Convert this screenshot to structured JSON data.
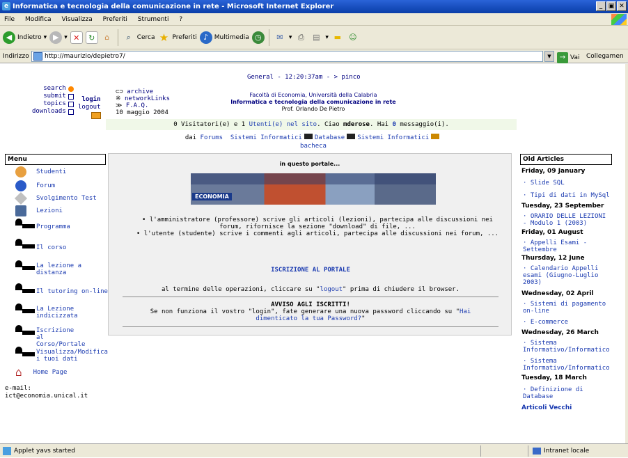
{
  "window": {
    "title": "Informatica e tecnologia della comunicazione in rete - Microsoft Internet Explorer",
    "min": "_",
    "max": " ",
    "close": " "
  },
  "menubar": [
    "File",
    "Modifica",
    "Visualizza",
    "Preferiti",
    "Strumenti",
    "?"
  ],
  "toolbar": {
    "back": "Indietro",
    "search": "Cerca",
    "favorites": "Preferiti",
    "media": "Multimedia"
  },
  "address": {
    "label": "Indirizzo",
    "url": "http://maurizio/depietro7/",
    "go": "Vai",
    "links": "Collegamen"
  },
  "page": {
    "general": "General - 12:20:37am - > pinco",
    "leftlinks": {
      "search": "search",
      "submit": "submit",
      "topics": "topics",
      "downloads": "downloads"
    },
    "login": "login",
    "logout": "logout",
    "rightlinks": {
      "archive": "archive",
      "network": "networkLinks",
      "faq": "F.A.Q.",
      "date": "10 maggio 2004"
    },
    "faculty": "Facoltà di Economia, Università della Calabria",
    "course": "Informatica e tecnologia della comunicazione in rete",
    "prof": "Prof. Orlando De Pietro",
    "visitors": {
      "pre": "0 Visitatori(e) e 1",
      "users": "Utenti(e) nel sito",
      "hello": ". Ciao",
      "user": "mderose",
      "has": ". Hai",
      "msgcount": "0",
      "msg": "messaggio(i)."
    },
    "dai": {
      "pre": "dai",
      "forums": "Forums",
      "si1": "Sistemi Informatici",
      "db": "Database",
      "si2": "Sistemi Informatici",
      "bacheca": "bacheca"
    },
    "menu": {
      "title": "Menu",
      "items": [
        "Studenti",
        "Forum",
        "Svolgimento Test",
        "Lezioni"
      ],
      "pict": [
        "Programma",
        "Il corso",
        "La lezione a distanza",
        "Il tutoring on-line",
        "La Lezione indicizzata",
        "Iscrizione al Corso/Portale",
        "Visualizza/Modifica i tuoi dati"
      ],
      "home": "Home Page"
    },
    "email_label": "e-mail:",
    "email": "ict@economia.unical.it",
    "main": {
      "heading": "in questo portale...",
      "banner": "ECONOMIA",
      "bullet1": "l'amministratore (professore) scrive gli articoli (lezioni), partecipa alle discussioni nei forum, rifornisce la sezione \"download\" di file, ...",
      "bullet2": "l'utente (studente) scrive i commenti agli articoli, partecipa alle discussioni nei forum, ...",
      "iscr": "ISCRIZIONE AL PORTALE",
      "term_pre": "al termine delle operazioni, cliccare su \"",
      "term_link": "logout",
      "term_post": "\" prima di chiudere il browser.",
      "avviso": "AVVISO AGLI ISCRITTI!",
      "avv_pre": "Se non funziona il vostro \"login\", fate generare una nuova password cliccando su \"",
      "avv_link": "Hai dimenticato la tua Password?",
      "avv_post": "\""
    },
    "old": {
      "title": "Old Articles",
      "d1": "Friday, 09 January",
      "a1": "Slide SQL",
      "a2": "Tipi di dati in MySql",
      "d2": "Tuesday, 23 September",
      "a3": "ORARIO DELLE LEZIONI - Modulo 1 (2003)",
      "d3": "Friday, 01 August",
      "a4": "Appelli Esami - Settembre",
      "d4": "Thursday, 12 June",
      "a5": "Calendario Appelli esami (Giugno-Luglio 2003)",
      "d5": "Wednesday, 02 April",
      "a6": "Sistemi di pagamento on-line",
      "a7": "E-commerce",
      "d6": "Wednesday, 26 March",
      "a8": "Sistema Informativo/Informatico",
      "a9": "Sistema Informativo/Informatico",
      "d7": "Tuesday, 18 March",
      "a10": "Definizione di Database",
      "more": "Articoli Vecchi"
    }
  },
  "status": {
    "text": "Applet yavs started",
    "zone": "Intranet locale"
  }
}
